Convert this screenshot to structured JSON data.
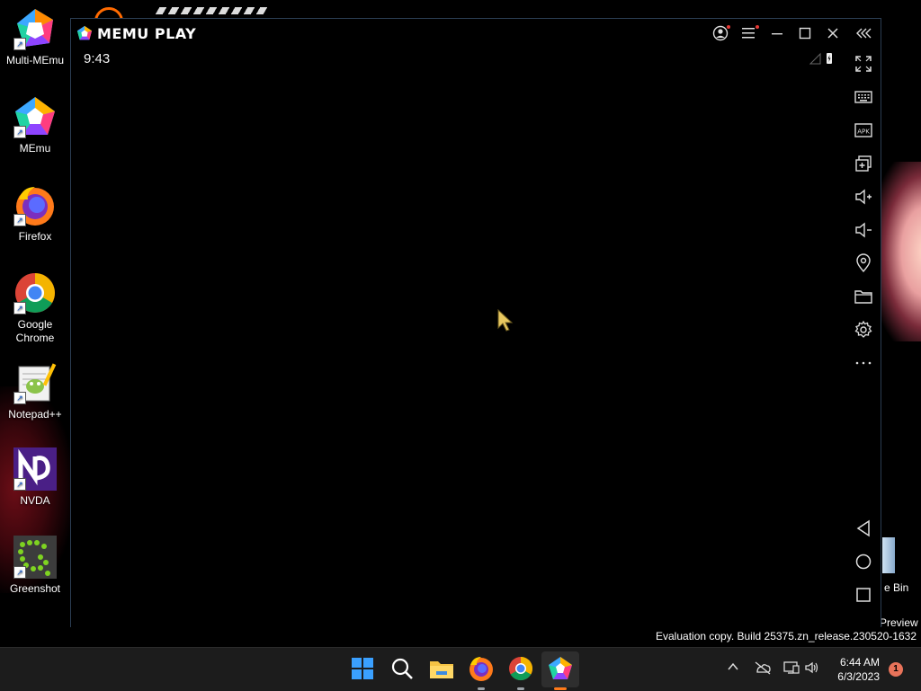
{
  "desktop": {
    "icons": [
      {
        "label": "Multi-MEmu",
        "icon": "multi-memu-icon"
      },
      {
        "label": "MEmu",
        "icon": "memu-icon"
      },
      {
        "label": "Firefox",
        "icon": "firefox-icon"
      },
      {
        "label": "Google\nChrome",
        "icon": "chrome-icon"
      },
      {
        "label": "Notepad++",
        "icon": "notepadpp-icon"
      },
      {
        "label": "NVDA",
        "icon": "nvda-icon"
      },
      {
        "label": "Greenshot",
        "icon": "greenshot-icon"
      }
    ],
    "recycle_bin_label_partial": "e Bin",
    "preview_label": "Preview",
    "watermark": "Evaluation copy. Build 25375.zn_release.230520-1632"
  },
  "emulator": {
    "title": "MEMU PLAY",
    "status_time": "9:43",
    "titlebar_buttons": [
      "account-icon",
      "menu-icon",
      "minimize-icon",
      "maximize-icon",
      "close-icon",
      "collapse-sidebar-icon"
    ],
    "sidebar_tools": [
      "fullscreen-icon",
      "keyboard-icon",
      "apk-icon",
      "multi-window-icon",
      "volume-up-icon",
      "volume-down-icon",
      "location-icon",
      "folder-icon",
      "settings-icon",
      "more-icon",
      "back-icon",
      "home-icon",
      "recents-icon"
    ],
    "apk_text": "APK"
  },
  "taskbar": {
    "apps": [
      "windows-start-icon",
      "search-icon",
      "file-explorer-icon",
      "firefox-icon",
      "chrome-icon",
      "memu-icon"
    ],
    "tray": [
      "chevron-up-icon",
      "network-off-icon",
      "display-icon",
      "speaker-icon"
    ],
    "time": "6:44 AM",
    "date": "6/3/2023",
    "notification_count": "1"
  },
  "colors": {
    "accent_red": "#e53935",
    "memu_orange": "#ff7a1a",
    "taskbar_bg": "#1c1c1c"
  }
}
